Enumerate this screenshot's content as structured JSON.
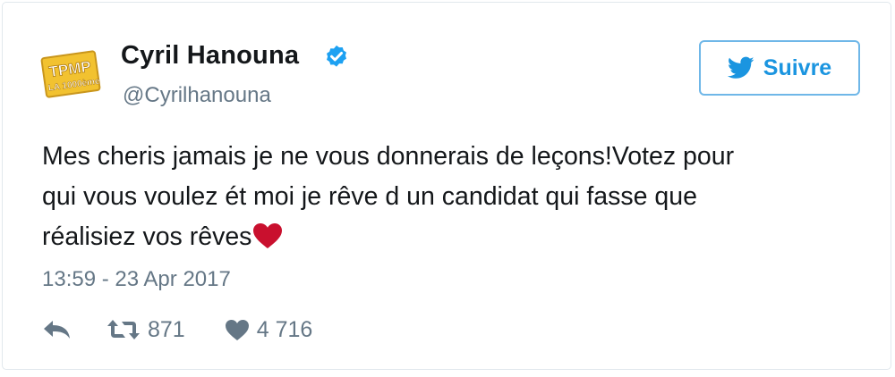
{
  "tweet": {
    "author_name": "Cyril Hanouna",
    "handle": "@Cyrilhanouna",
    "verified": true,
    "text_lines": [
      "Mes cheris jamais je ne vous donnerais de leçons!Votez pour",
      "qui vous voulez ét moi je rêve d un candidat qui fasse que",
      "réalisiez vos rêves"
    ],
    "emoji": "heart-emoji",
    "timestamp": "13:59 - 23 Apr 2017",
    "retweet_count": "871",
    "like_count": "4 716"
  },
  "avatar": {
    "logo_text_main": "TPMP",
    "logo_text_sub": "LA 1000ème"
  },
  "follow_button": {
    "label": "Suivre"
  },
  "icons": {
    "verified": "verified-badge-icon",
    "follow": "twitter-bird-icon",
    "reply": "reply-icon",
    "retweet": "retweet-icon",
    "like": "heart-icon"
  },
  "colors": {
    "accent": "#1b95e0",
    "verified_blue": "#1da1f2",
    "text": "#14171a",
    "muted": "#657786",
    "heart_red": "#c9102e",
    "logo_gold": "#f2c230"
  }
}
